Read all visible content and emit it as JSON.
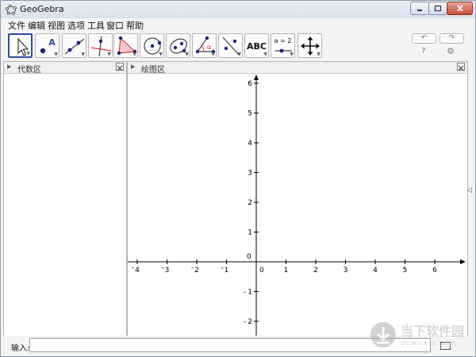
{
  "window": {
    "title": "GeoGebra"
  },
  "menu": [
    "文件",
    "编辑",
    "视图",
    "选项",
    "工具",
    "窗口",
    "帮助"
  ],
  "toolbar": {
    "tools": [
      {
        "name": "move-tool",
        "selected": true
      },
      {
        "name": "point-tool",
        "label": "A"
      },
      {
        "name": "line-tool"
      },
      {
        "name": "perpendicular-line-tool"
      },
      {
        "name": "polygon-tool"
      },
      {
        "name": "circle-tool"
      },
      {
        "name": "ellipse-tool"
      },
      {
        "name": "angle-tool",
        "label": "α"
      },
      {
        "name": "reflect-tool"
      },
      {
        "name": "text-tool",
        "label": "ABC"
      },
      {
        "name": "slider-tool",
        "label": "a = 2"
      },
      {
        "name": "move-graphics-view-tool"
      }
    ]
  },
  "panels": {
    "algebra": {
      "title": "代数区"
    },
    "graphics": {
      "title": "绘图区"
    }
  },
  "graph": {
    "x_ticks": [
      "4",
      "3",
      "2",
      "1",
      "0",
      "1",
      "2",
      "3",
      "4",
      "5",
      "6"
    ],
    "x_tick_values": [
      -4,
      -3,
      -2,
      -1,
      0,
      1,
      2,
      3,
      4,
      5,
      6
    ],
    "y_ticks": [
      "6",
      "5",
      "4",
      "3",
      "2",
      "1",
      "1",
      "2"
    ],
    "y_tick_values": [
      6,
      5,
      4,
      3,
      2,
      1,
      -1,
      -2
    ],
    "origin_label": "0"
  },
  "inputbar": {
    "label": "输入:"
  },
  "watermark": {
    "text": "当下软件园",
    "subtext": "downxia.com"
  },
  "colors": {
    "tool_accent": "#2a4fa3",
    "point": "#1a237e",
    "angle": "#d33"
  }
}
